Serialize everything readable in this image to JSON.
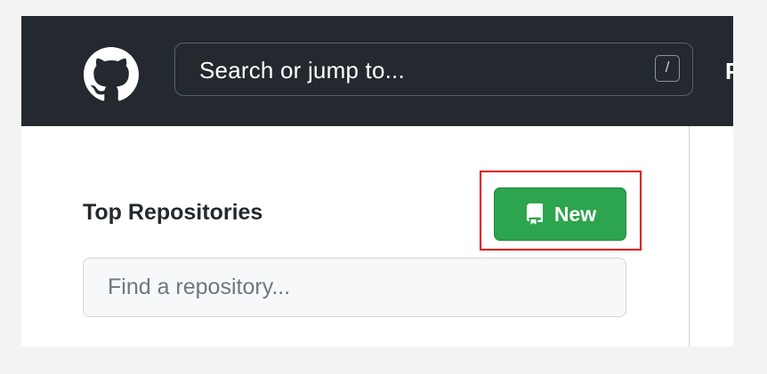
{
  "header": {
    "logo_icon": "github-octocat-icon",
    "search_placeholder": "Search or jump to...",
    "search_shortcut": "/",
    "cut_off_nav_letter": "P"
  },
  "sidebar": {
    "section_title": "Top Repositories",
    "new_button_label": "New",
    "new_button_icon": "repo-icon",
    "find_placeholder": "Find a repository..."
  },
  "colors": {
    "header_bg": "#24292f",
    "new_button_bg": "#2da44e",
    "highlight_border": "#e00000",
    "input_bg": "#f6f8fa"
  }
}
